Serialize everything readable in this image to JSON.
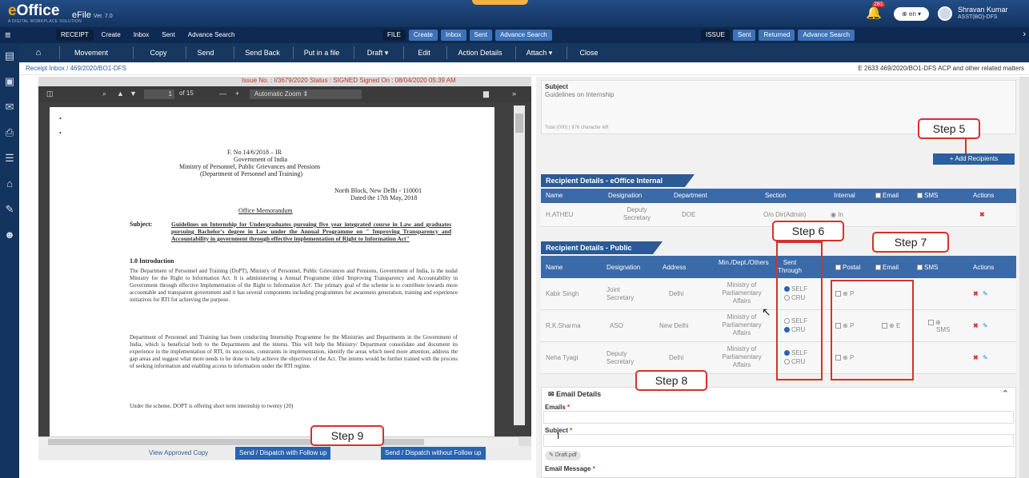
{
  "header": {
    "logo": "eOffice",
    "logo_tagline": "A DIGITAL WORKPLACE SOLUTION",
    "app_name": "eFile",
    "version": "Ver. 7.0",
    "notification_count": "281",
    "language": "en",
    "user_name": "Shravan Kumar",
    "user_role": "ASST(BO)-DFS"
  },
  "menu": {
    "receipt": {
      "head": "RECEIPT",
      "items": [
        "Create",
        "Inbox",
        "Sent",
        "Advance Search"
      ]
    },
    "file": {
      "head": "FILE",
      "items": [
        "Create",
        "Inbox",
        "Sent",
        "Advance Search"
      ]
    },
    "issue": {
      "head": "ISSUE",
      "items": [
        "Sent",
        "Returned",
        "Advance Search"
      ]
    }
  },
  "toolbar": [
    "Movement",
    "Copy",
    "Send",
    "Send Back",
    "Put in a file",
    "Draft",
    "Edit",
    "Action Details",
    "Attach",
    "Close"
  ],
  "breadcrumb": "Receipt Inbox / 469/2020/BO1-DFS",
  "receipt_info": "E 2633 469/2020/BO1-DFS ACP and other related matters",
  "viewer": {
    "status_line": "Issue No. : I/3679/2020 Status : SIGNED Signed On : 08/04/2020 05:39 AM",
    "page_current": "1",
    "page_total": "of 15",
    "zoom": "Automatic Zoom"
  },
  "document": {
    "file_no": "F. No 14/6/2018 – IR",
    "govt": "Government of India",
    "ministry": "Ministry of Personnel, Public Grievances and Pensions",
    "dept": "(Department of Personnel and Training)",
    "address": "North Block, New Delhi - 110001",
    "date": "Dated the 17th May, 2018",
    "om": "Office Memorandum",
    "subject_label": "Subject:",
    "subject_text": "Guidelines on Internship for Undergraduates pursuing five year integrated course in Law and graduates pursuing Bachelor's degree in Law under the Annual Programme on \" Improving Transparency and Accountability in government through effective implementation of Right to Information Act\"",
    "intro_heading": "1.0 Introduction",
    "para1": "The Department of Personnel and Training (DoPT), Ministry of Personnel, Public Grievances and Pensions, Government of India, is the nodal Ministry for the Right to Information Act. It is administering a Annual Programme titled 'Improving Transparency and Accountability in Government through effective Implementation of the Right to Information Act'. The primary goal of the scheme is to contribute towards more accountable and transparent government and it has several components including programmes for awareness generation, training and experience initiatives for RTI for achieving the purpose.",
    "para2": "Department of Personnel and Training has been conducting Internship Programme for the Ministries and Departments in the Government of India, which is beneficial both to the Departments and the interns. This will help the Ministry/ Department consolidate and document its experience in the implementation of RTI, its successes, constraints in implementation, identify the areas which need more attention, address the gap areas and suggest what more needs to be done to help achieve the objectives of the Act. The interns would be further trained with the process of seeking information and enabling access to information under the RTI regime.",
    "para3": "Under the scheme, DOPT is offering short term internship to twenty (20)"
  },
  "send_bar": {
    "view_copy": "View Approved Copy",
    "send_follow": "Send / Dispatch with Follow up",
    "send_nofollow": "Send / Dispatch without Follow up"
  },
  "subject_box": {
    "label": "Subject",
    "value": "Guidelines on Internship",
    "counter": "Total (000) | 976 character left"
  },
  "add_recipients": "+ Add Recipients",
  "internal": {
    "title": "Recipient Details - eOffice Internal",
    "headers": [
      "Name",
      "Designation",
      "Department",
      "Section",
      "Internal",
      "Email",
      "SMS",
      "Actions"
    ],
    "rows": [
      {
        "name": "H.ATHEU",
        "designation": "Deputy Secretary",
        "department": "DOE",
        "section": "O/o Dir(Admin)",
        "internal": "In"
      }
    ]
  },
  "public": {
    "title": "Recipient Details - Public",
    "headers": [
      "Name",
      "Designation",
      "Address",
      "Min./Dept./Others",
      "Sent Through",
      "Postal",
      "Email",
      "SMS",
      "Actions"
    ],
    "rows": [
      {
        "name": "Kabir Singh",
        "designation": "Joint Secretary",
        "address": "Delhi",
        "ministry": "Ministry of Parliamentary Affairs",
        "self": "SELF",
        "cru": "CRU",
        "selected": "SELF",
        "postal": "P"
      },
      {
        "name": "R.K.Sharma",
        "designation": "ASO",
        "address": "New Delhi",
        "ministry": "Ministry of Parliamentary Affairs",
        "self": "SELF",
        "cru": "CRU",
        "selected": "CRU",
        "postal": "P",
        "email": "E",
        "sms": "SMS"
      },
      {
        "name": "Neha Tyagi",
        "designation": "Deputy Secretary",
        "address": "Delhi",
        "ministry": "Ministry of Parliamentary Affairs",
        "self": "SELF",
        "cru": "CRU",
        "selected": "SELF",
        "postal": "P"
      }
    ]
  },
  "email_details": {
    "title": "Email Details",
    "emails_label": "Emails",
    "subject_label": "Subject",
    "attachment": "Draft.pdf",
    "message_label": "Email Message"
  },
  "steps": {
    "s5": "Step 5",
    "s6": "Step 6",
    "s7": "Step 7",
    "s8": "Step 8",
    "s9": "Step 9"
  },
  "colors": {
    "header": "#1c3f6e",
    "accent": "#2c5a94",
    "callout": "#d4322b"
  }
}
